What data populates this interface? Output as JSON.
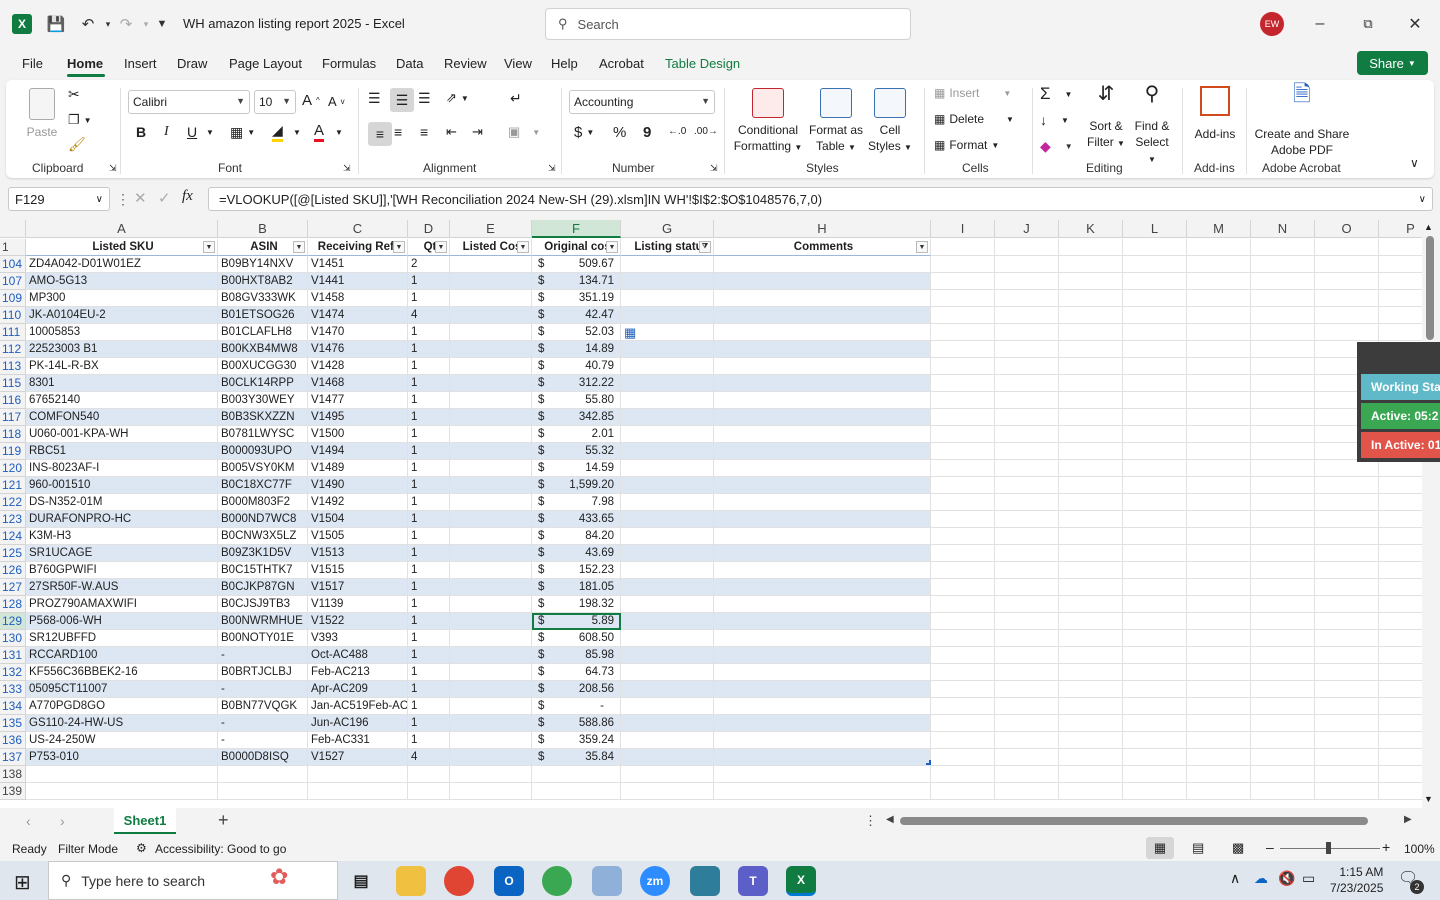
{
  "titlebar": {
    "doc_title": "WH amazon listing report 2025  -  Excel",
    "search_placeholder": "Search",
    "avatar": "EW",
    "app_icon": "X"
  },
  "menu": {
    "items": [
      "File",
      "Home",
      "Insert",
      "Draw",
      "Page Layout",
      "Formulas",
      "Data",
      "Review",
      "View",
      "Help",
      "Acrobat",
      "Table Design"
    ],
    "share": "Share"
  },
  "ribbon": {
    "clipboard": {
      "label": "Clipboard",
      "paste": "Paste"
    },
    "font": {
      "label": "Font",
      "name": "Calibri",
      "size": "10",
      "bold": "B",
      "italic": "I",
      "underline": "U"
    },
    "alignment": {
      "label": "Alignment"
    },
    "number": {
      "label": "Number",
      "format": "Accounting",
      "currency": "$",
      "percent": "%",
      "comma": "9"
    },
    "styles": {
      "label": "Styles",
      "cond1": "Conditional",
      "cond2": "Formatting",
      "fmt1": "Format as",
      "fmt2": "Table",
      "cell1": "Cell",
      "cell2": "Styles"
    },
    "cells": {
      "label": "Cells",
      "insert": "Insert",
      "delete": "Delete",
      "format": "Format"
    },
    "editing": {
      "label": "Editing",
      "sort1": "Sort &",
      "sort2": "Filter",
      "find1": "Find &",
      "find2": "Select"
    },
    "addins": {
      "label": "Add-ins",
      "btn": "Add-ins"
    },
    "acrobat": {
      "label": "Adobe Acrobat",
      "btn1": "Create and Share",
      "btn2": "Adobe PDF"
    }
  },
  "formula": {
    "namebox": "F129",
    "fx": "fx",
    "content": "=VLOOKUP([@[Listed SKU]],'[WH Reconciliation 2024 New-SH (29).xlsm]IN WH'!$I$2:$O$1048576,7,0)"
  },
  "columns": [
    "A",
    "B",
    "C",
    "D",
    "E",
    "F",
    "G",
    "H",
    "I",
    "J",
    "K",
    "L",
    "M",
    "N",
    "O",
    "P"
  ],
  "table_headers": [
    "Listed SKU",
    "ASIN",
    "Receiving Ref#",
    "Qt",
    "Listed Cos",
    "Original cos",
    "Listing statu",
    "Comments"
  ],
  "header_row": "1",
  "rows": [
    {
      "r": "104",
      "a": "ZD4A042-D01W01EZ",
      "b": "B09BY14NXV",
      "c": "V1451",
      "d": "2",
      "f": "509.67"
    },
    {
      "r": "107",
      "a": "AMO-5G13",
      "b": "B00HXT8AB2",
      "c": "V1441",
      "d": "1",
      "f": "134.71"
    },
    {
      "r": "109",
      "a": "MP300",
      "b": "B08GV333WK",
      "c": "V1458",
      "d": "1",
      "f": "351.19"
    },
    {
      "r": "110",
      "a": "JK-A0104EU-2",
      "b": "B01ETSOG26",
      "c": "V1474",
      "d": "4",
      "f": "42.47"
    },
    {
      "r": "111",
      "a": "10005853",
      "b": "B01CLAFLH8",
      "c": "V1470",
      "d": "1",
      "f": "52.03"
    },
    {
      "r": "112",
      "a": "22523003 B1",
      "b": "B00KXB4MW8",
      "c": "V1476",
      "d": "1",
      "f": "14.89"
    },
    {
      "r": "113",
      "a": "PK-14L-R-BX",
      "b": "B00XUCGG30",
      "c": "V1428",
      "d": "1",
      "f": "40.79"
    },
    {
      "r": "115",
      "a": "8301",
      "b": "B0CLK14RPP",
      "c": "V1468",
      "d": "1",
      "f": "312.22"
    },
    {
      "r": "116",
      "a": "67652140",
      "b": "B003Y30WEY",
      "c": "V1477",
      "d": "1",
      "f": "55.80"
    },
    {
      "r": "117",
      "a": "COMFON540",
      "b": "B0B3SKXZZN",
      "c": "V1495",
      "d": "1",
      "f": "342.85"
    },
    {
      "r": "118",
      "a": "U060-001-KPA-WH",
      "b": "B0781LWYSC",
      "c": "V1500",
      "d": "1",
      "f": "2.01"
    },
    {
      "r": "119",
      "a": "RBC51",
      "b": "B000093UPO",
      "c": "V1494",
      "d": "1",
      "f": "55.32"
    },
    {
      "r": "120",
      "a": "INS-8023AF-I",
      "b": "B005VSY0KM",
      "c": "V1489",
      "d": "1",
      "f": "14.59"
    },
    {
      "r": "121",
      "a": "960-001510",
      "b": "B0C18XC77F",
      "c": "V1490",
      "d": "1",
      "f": "1,599.20"
    },
    {
      "r": "122",
      "a": "DS-N352-01M",
      "b": "B000M803F2",
      "c": "V1492",
      "d": "1",
      "f": "7.98"
    },
    {
      "r": "123",
      "a": "DURAFONPRO-HC",
      "b": "B000ND7WC8",
      "c": "V1504",
      "d": "1",
      "f": "433.65"
    },
    {
      "r": "124",
      "a": "K3M-H3",
      "b": "B0CNW3X5LZ",
      "c": "V1505",
      "d": "1",
      "f": "84.20"
    },
    {
      "r": "125",
      "a": "SR1UCAGE",
      "b": "B09Z3K1D5V",
      "c": "V1513",
      "d": "1",
      "f": "43.69"
    },
    {
      "r": "126",
      "a": "B760GPWIFI",
      "b": "B0C15THTK7",
      "c": "V1515",
      "d": "1",
      "f": "152.23"
    },
    {
      "r": "127",
      "a": "27SR50F-W.AUS",
      "b": "B0CJKP87GN",
      "c": "V1517",
      "d": "1",
      "f": "181.05"
    },
    {
      "r": "128",
      "a": "PROZ790AMAXWIFI",
      "b": "B0CJSJ9TB3",
      "c": "V1139",
      "d": "1",
      "f": "198.32"
    },
    {
      "r": "129",
      "a": "P568-006-WH",
      "b": "B00NWRMHUE",
      "c": "V1522",
      "d": "1",
      "f": "5.89"
    },
    {
      "r": "130",
      "a": "SR12UBFFD",
      "b": "B00NOTY01E",
      "c": "V393",
      "d": "1",
      "f": "608.50"
    },
    {
      "r": "131",
      "a": "RCCARD100",
      "b": "-",
      "c": "Oct-AC488",
      "d": "1",
      "f": "85.98"
    },
    {
      "r": "132",
      "a": "KF556C36BBEK2-16",
      "b": "B0BRTJCLBJ",
      "c": "Feb-AC213",
      "d": "1",
      "f": "64.73"
    },
    {
      "r": "133",
      "a": "05095CT11007",
      "b": "-",
      "c": "Apr-AC209",
      "d": "1",
      "f": "208.56"
    },
    {
      "r": "134",
      "a": "A770PGD8GO",
      "b": "B0BN77VQGK",
      "c": "Jan-AC519Feb-AC4",
      "d": "1",
      "f": "-"
    },
    {
      "r": "135",
      "a": "GS110-24-HW-US",
      "b": "-",
      "c": "Jun-AC196",
      "d": "1",
      "f": "588.86"
    },
    {
      "r": "136",
      "a": "US-24-250W",
      "b": "-",
      "c": "Feb-AC331",
      "d": "1",
      "f": "359.24"
    },
    {
      "r": "137",
      "a": "P753-010",
      "b": "B0000D8ISQ",
      "c": "V1527",
      "d": "4",
      "f": "35.84"
    }
  ],
  "empty_rows": [
    "138",
    "139"
  ],
  "widget": {
    "working": "Working Sta",
    "active": "Active: 05:2",
    "inactive": "In Active: 01"
  },
  "sheet": {
    "tab": "Sheet1",
    "add": "+"
  },
  "status": {
    "ready": "Ready",
    "filter": "Filter Mode",
    "accessibility": "Accessibility: Good to go",
    "zoom": "100%"
  },
  "taskbar": {
    "search": "Type here to search",
    "time": "1:15 AM",
    "date": "7/23/2025",
    "notif": "2"
  },
  "colors": {
    "excel_green": "#107c41",
    "band": "#dde7f3",
    "avatar": "#c4262e",
    "widget_working": "#5fb9c9",
    "widget_active": "#3aa853",
    "widget_inactive": "#e0544a"
  }
}
